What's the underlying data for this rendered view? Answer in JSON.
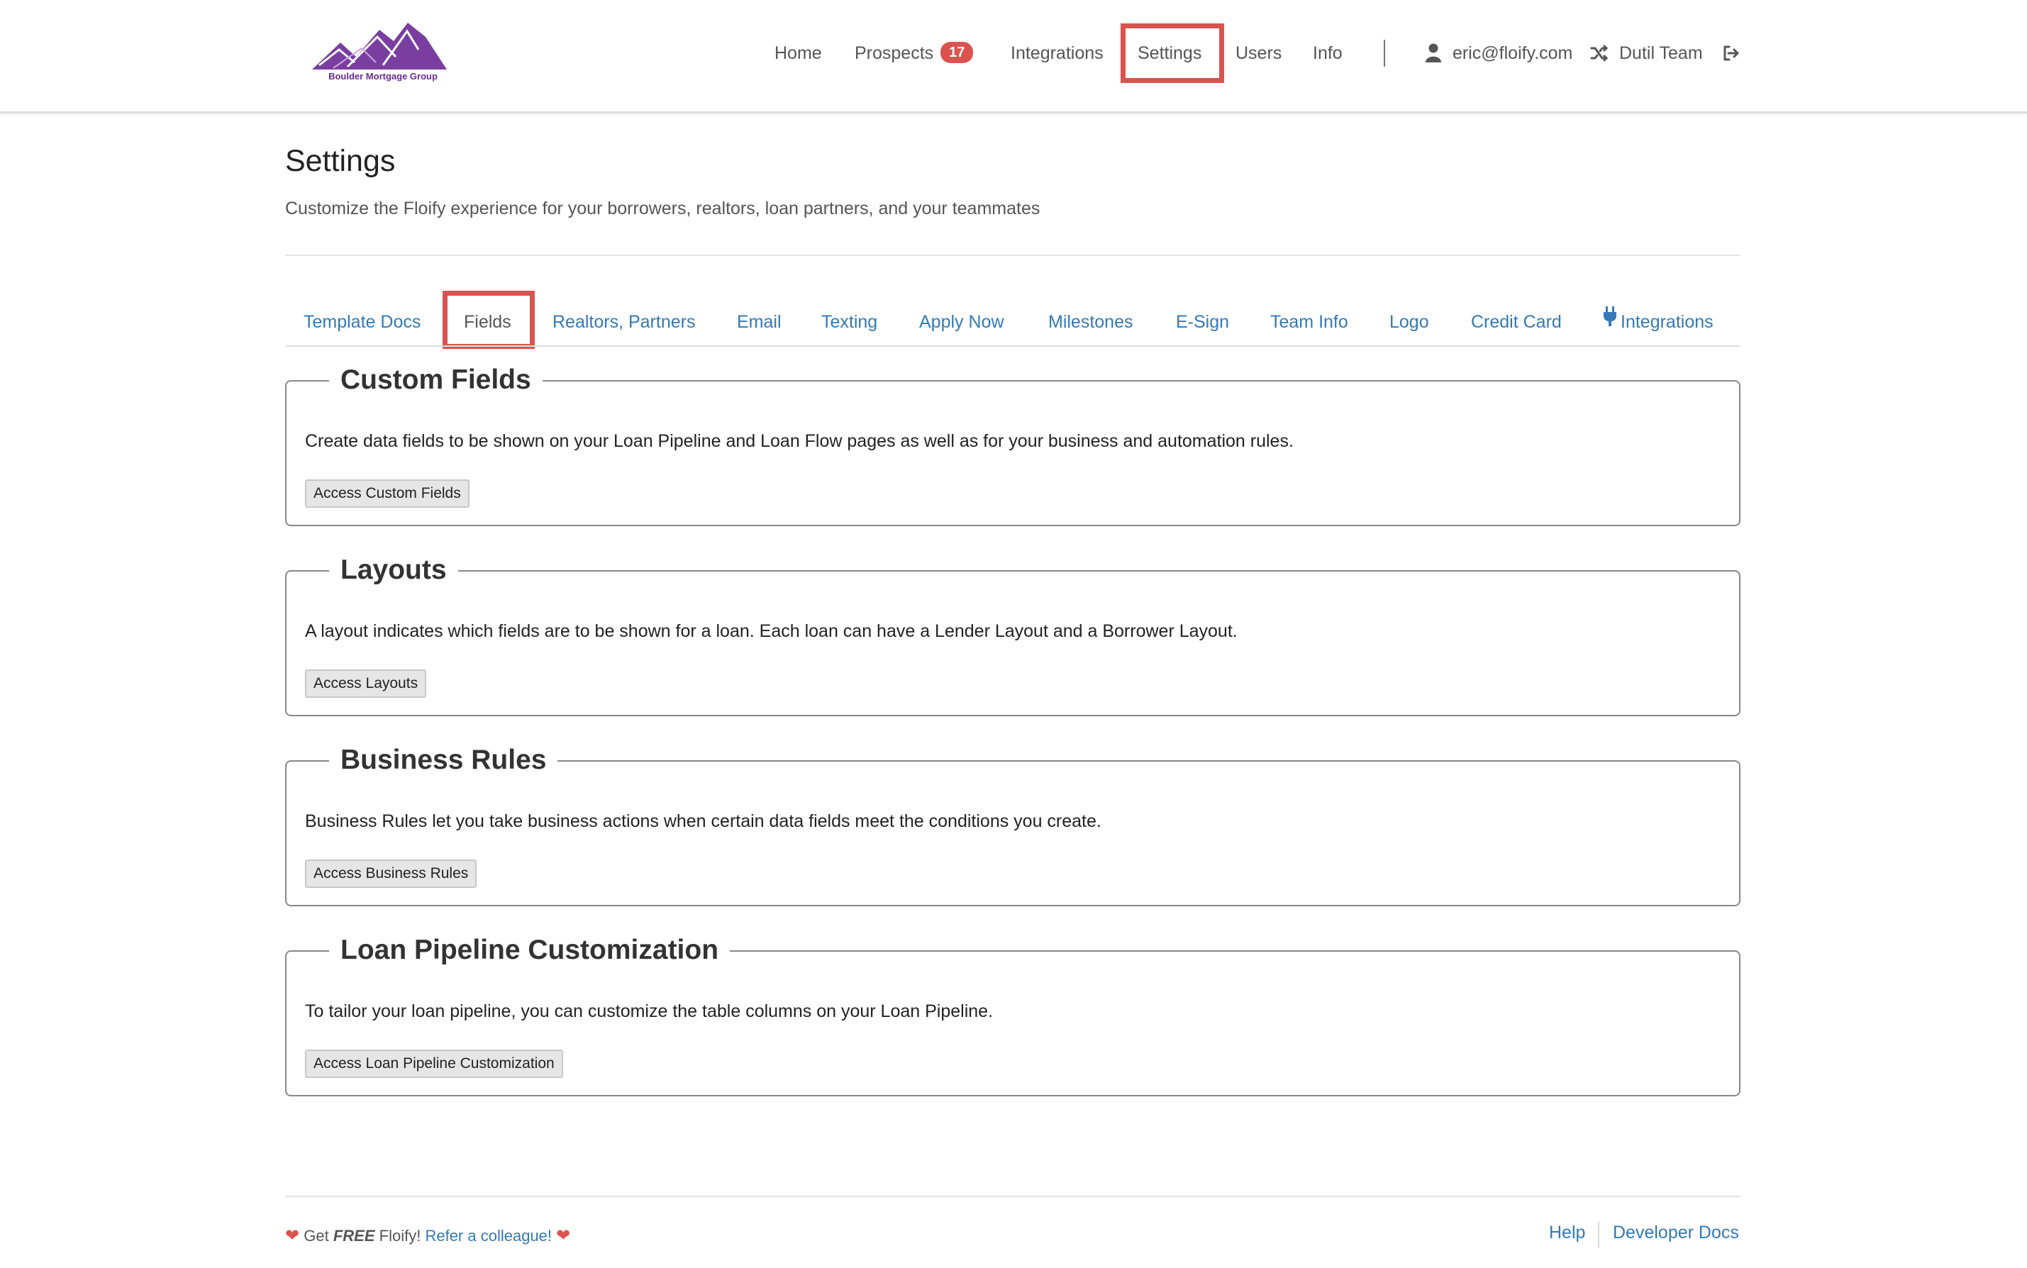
{
  "brand": {
    "logo_text": "Boulder Mortgage Group",
    "color": "#6a2d91"
  },
  "nav": {
    "home": "Home",
    "prospects": "Prospects",
    "prospects_count": "17",
    "integrations": "Integrations",
    "settings": "Settings",
    "users": "Users",
    "info": "Info",
    "user_email": "eric@floify.com",
    "team": "Dutil Team",
    "user_icon": "user-icon",
    "switch_icon": "shuffle-icon",
    "logout_icon": "sign-out-icon"
  },
  "header": {
    "title": "Settings",
    "subtitle": "Customize the Floify experience for your borrowers, realtors, loan partners, and your teammates"
  },
  "tabs": [
    {
      "label": "Template Docs"
    },
    {
      "label": "Fields",
      "active": true
    },
    {
      "label": "Realtors, Partners"
    },
    {
      "label": "Email"
    },
    {
      "label": "Texting"
    },
    {
      "label": "Apply Now"
    },
    {
      "label": "Milestones"
    },
    {
      "label": "E-Sign"
    },
    {
      "label": "Team Info"
    },
    {
      "label": "Logo"
    },
    {
      "label": "Credit Card"
    },
    {
      "label": "Integrations",
      "icon": "plug-icon"
    }
  ],
  "sections": [
    {
      "title": "Custom Fields",
      "description": "Create data fields to be shown on your Loan Pipeline and Loan Flow pages as well as for your business and automation rules.",
      "button": "Access Custom Fields"
    },
    {
      "title": "Layouts",
      "description": "A layout indicates which fields are to be shown for a loan. Each loan can have a Lender Layout and a Borrower Layout.",
      "button": "Access Layouts"
    },
    {
      "title": "Business Rules",
      "description": "Business Rules let you take business actions when certain data fields meet the conditions you create.",
      "button": "Access Business Rules"
    },
    {
      "title": "Loan Pipeline Customization",
      "description": "To tailor your loan pipeline, you can customize the table columns on your Loan Pipeline.",
      "button": "Access Loan Pipeline Customization"
    }
  ],
  "footer": {
    "get": "Get",
    "free": "FREE",
    "floify": "Floify!",
    "refer": "Refer a colleague!",
    "help": "Help",
    "developer_docs": "Developer Docs"
  },
  "colors": {
    "link": "#337ab7",
    "highlight": "#d9534f",
    "badge": "#d9534f"
  }
}
